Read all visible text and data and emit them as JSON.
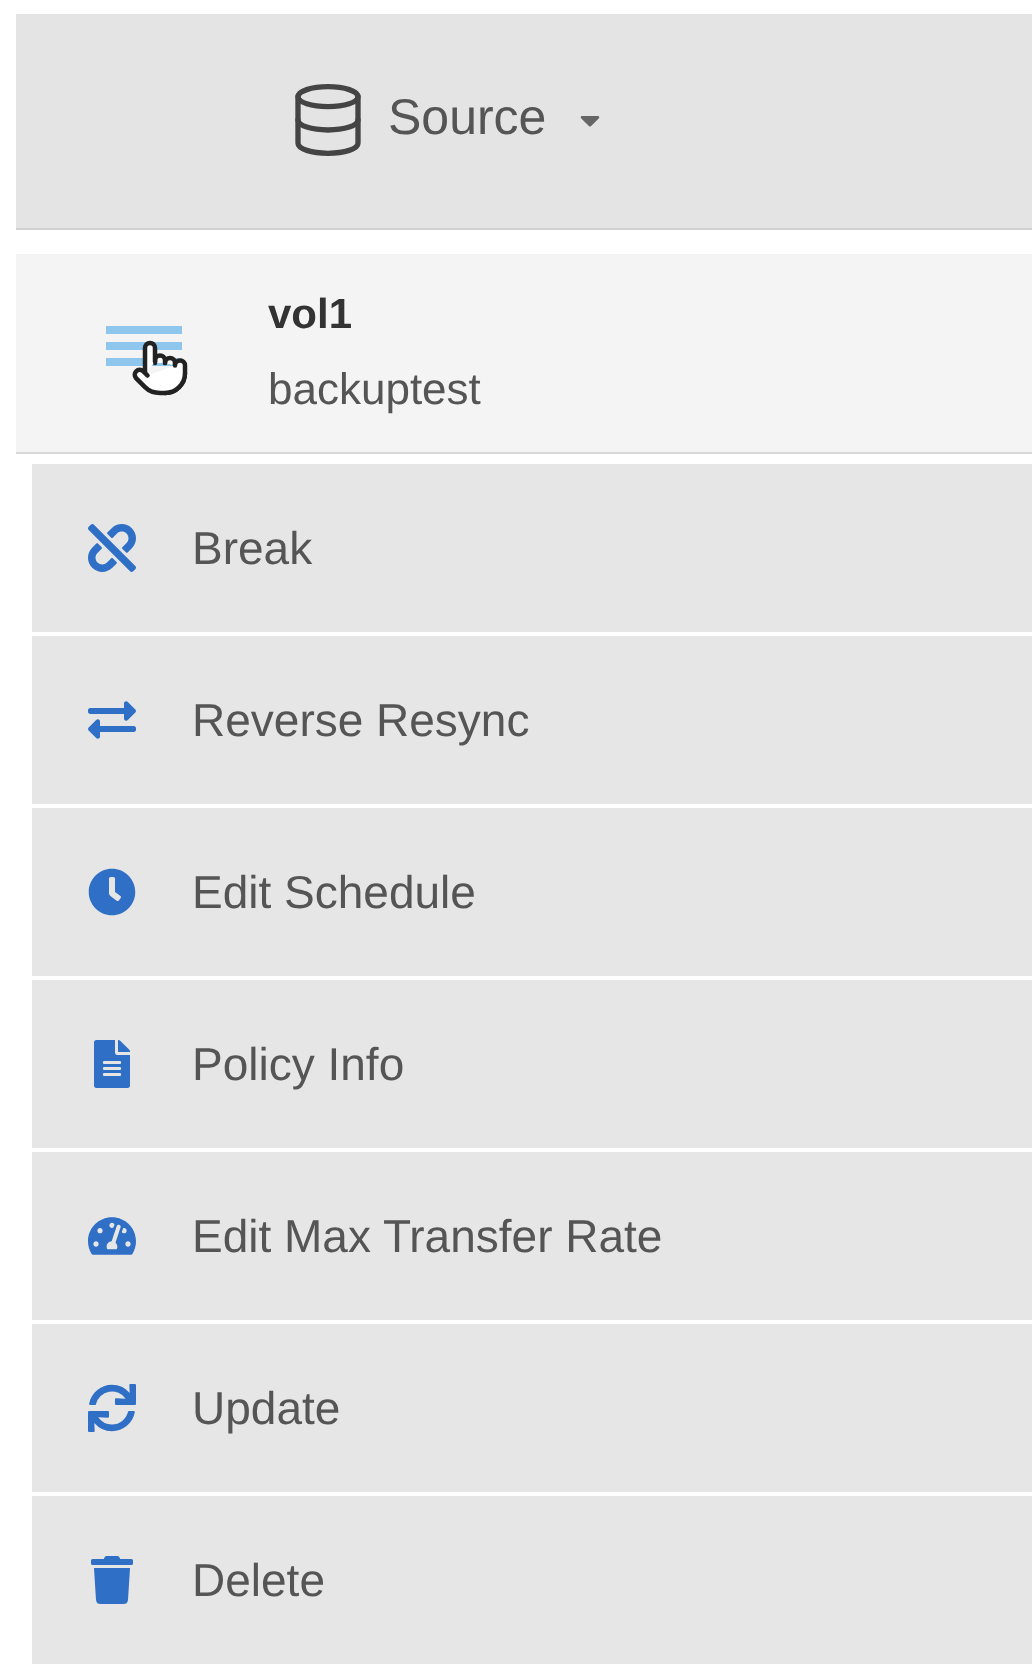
{
  "header": {
    "label": "Source"
  },
  "volume": {
    "name": "vol1",
    "subtitle": "backuptest"
  },
  "menu": [
    {
      "kind": "break",
      "label": "Break"
    },
    {
      "kind": "reverse",
      "label": "Reverse Resync"
    },
    {
      "kind": "schedule",
      "label": "Edit Schedule"
    },
    {
      "kind": "policy",
      "label": "Policy Info"
    },
    {
      "kind": "rate",
      "label": "Edit Max Transfer Rate"
    },
    {
      "kind": "update",
      "label": "Update"
    },
    {
      "kind": "delete",
      "label": "Delete"
    }
  ]
}
